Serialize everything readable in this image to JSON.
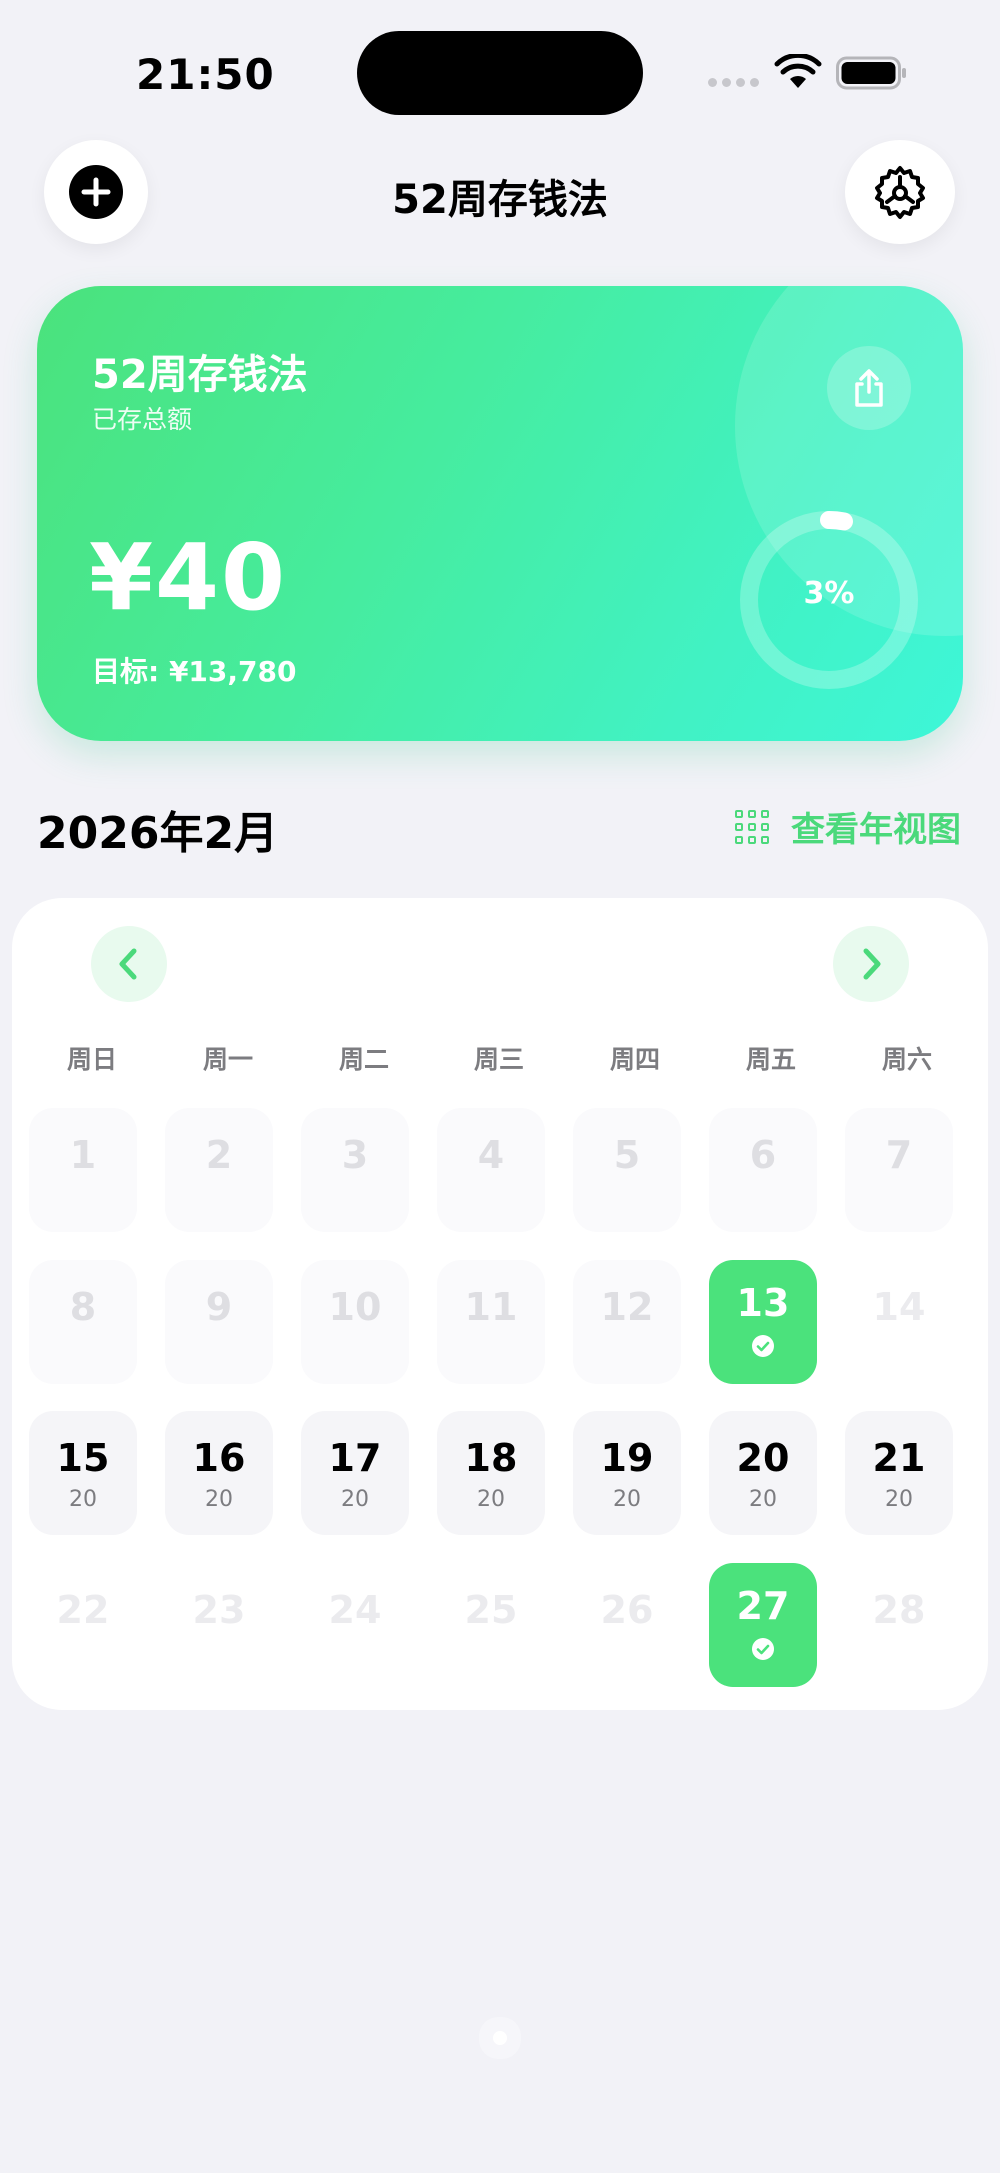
{
  "status_bar": {
    "time": "21:50"
  },
  "header": {
    "title": "52周存钱法"
  },
  "hero": {
    "title": "52周存钱法",
    "subtitle": "已存总额",
    "amount": "¥40",
    "target": "目标: ¥13,780",
    "progress_text": "3%",
    "progress_fraction": 0.03,
    "accent_color": "#4be27c"
  },
  "month": {
    "title": "2026年2月",
    "year_view_label": "查看年视图"
  },
  "calendar": {
    "weekdays": [
      "周日",
      "周一",
      "周二",
      "周三",
      "周四",
      "周五",
      "周六"
    ],
    "days": [
      {
        "num": "1",
        "state": "past"
      },
      {
        "num": "2",
        "state": "past"
      },
      {
        "num": "3",
        "state": "past"
      },
      {
        "num": "4",
        "state": "past"
      },
      {
        "num": "5",
        "state": "past"
      },
      {
        "num": "6",
        "state": "past"
      },
      {
        "num": "7",
        "state": "past"
      },
      {
        "num": "8",
        "state": "past"
      },
      {
        "num": "9",
        "state": "past"
      },
      {
        "num": "10",
        "state": "past"
      },
      {
        "num": "11",
        "state": "past"
      },
      {
        "num": "12",
        "state": "past"
      },
      {
        "num": "13",
        "state": "done"
      },
      {
        "num": "14",
        "state": "future"
      },
      {
        "num": "15",
        "amount": "20",
        "state": "active"
      },
      {
        "num": "16",
        "amount": "20",
        "state": "active"
      },
      {
        "num": "17",
        "amount": "20",
        "state": "active"
      },
      {
        "num": "18",
        "amount": "20",
        "state": "active"
      },
      {
        "num": "19",
        "amount": "20",
        "state": "active"
      },
      {
        "num": "20",
        "amount": "20",
        "state": "active"
      },
      {
        "num": "21",
        "amount": "20",
        "state": "active"
      },
      {
        "num": "22",
        "state": "future"
      },
      {
        "num": "23",
        "state": "future"
      },
      {
        "num": "24",
        "state": "future"
      },
      {
        "num": "25",
        "state": "future"
      },
      {
        "num": "26",
        "state": "future"
      },
      {
        "num": "27",
        "state": "done"
      },
      {
        "num": "28",
        "state": "future"
      }
    ]
  }
}
